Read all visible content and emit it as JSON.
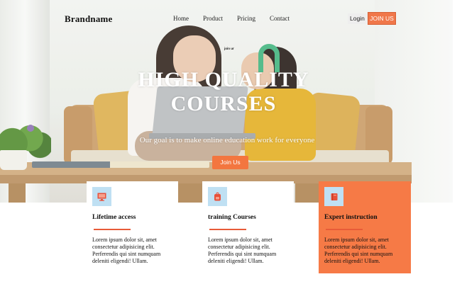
{
  "nav": {
    "brand": "Brandname",
    "links": [
      "Home",
      "Product",
      "Pricing",
      "Contact"
    ],
    "login_label": "Login",
    "join_label": "JOIN US"
  },
  "hero": {
    "tiny_label": "join ur",
    "title_line1": "HIGH QUALITY",
    "title_line2": "COURSES",
    "subtitle": "Our goal is to make online education work for everyone",
    "cta_label": "Join Us"
  },
  "features": [
    {
      "icon": "monitor-icon",
      "title": "Lifetime access",
      "text": "Lorem ipsum dolor sit, amet consectetur adipisicing elit. Perferendis qui sint numquam deleniti eligendi! Ullam."
    },
    {
      "icon": "backpack-icon",
      "title": "training Courses",
      "text": "Lorem ipsum dolor sit, amet consectetur adipisicing elit. Perferendis qui sint numquam deleniti eligendi! Ullam."
    },
    {
      "icon": "book-icon",
      "title": "Expert instruction",
      "text": "Lorem ipsum dolor sit, amet consectetur adipisicing elit. Perferendis qui sint numquam deleniti eligendi! Ullam."
    }
  ],
  "colors": {
    "accent": "#f3763f",
    "icon_bg": "#bfe0f3",
    "highlight_card": "#f67a46",
    "icon_red": "#e8503a"
  }
}
